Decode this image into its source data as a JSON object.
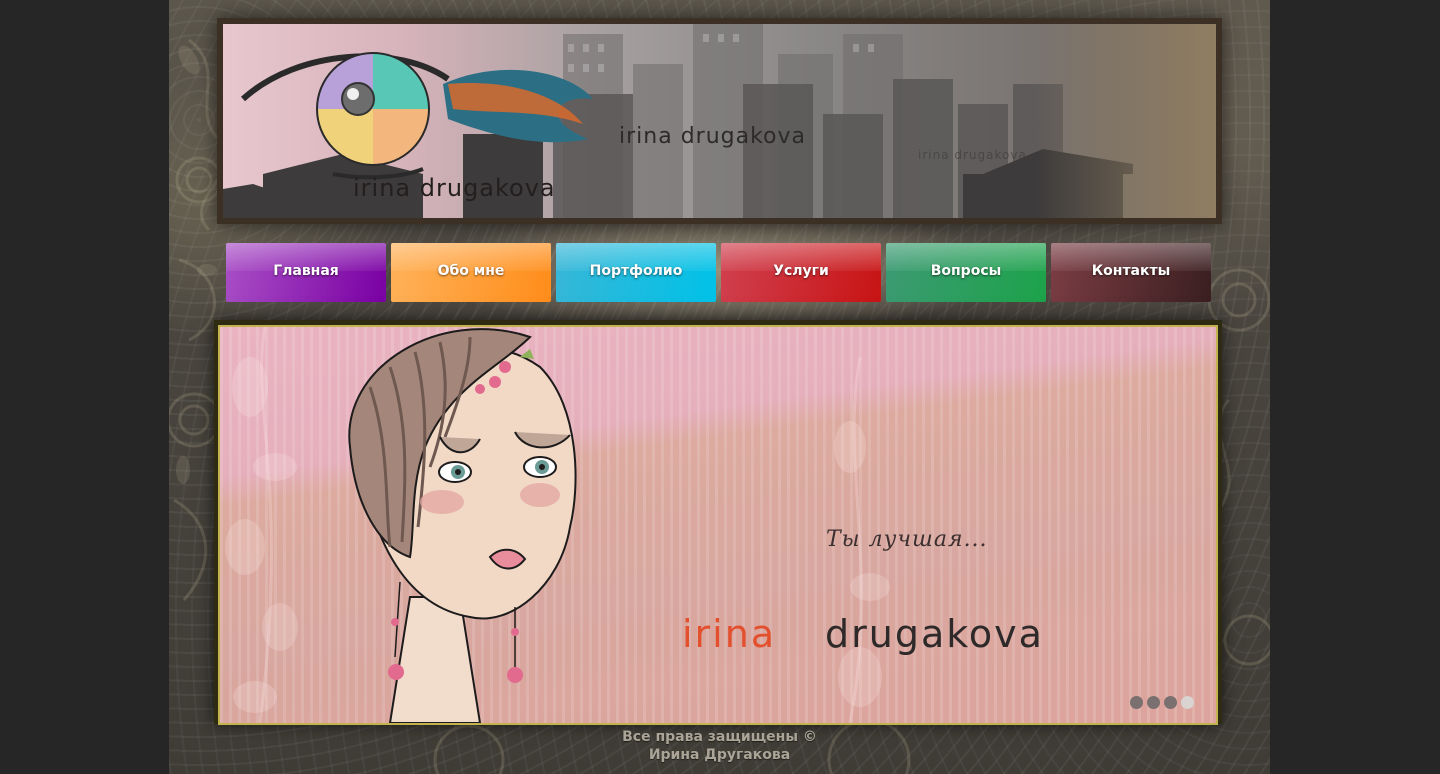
{
  "header": {
    "logo_text": "irina drugakova",
    "logo_text_mid": "irina drugakova",
    "logo_text_small": "irina drugakova"
  },
  "nav": {
    "items": [
      {
        "label": "Главная",
        "color_top": "#a94fc6",
        "color_bottom": "#7a00a3"
      },
      {
        "label": "Обо мне",
        "color_top": "#ffb25a",
        "color_bottom": "#ff8d1a"
      },
      {
        "label": "Портфолио",
        "color_top": "#38b6d6",
        "color_bottom": "#00c2e8"
      },
      {
        "label": "Услуги",
        "color_top": "#d0404f",
        "color_bottom": "#c81414"
      },
      {
        "label": "Вопросы",
        "color_top": "#3c9a73",
        "color_bottom": "#1da34a"
      },
      {
        "label": "Контакты",
        "color_top": "#7b3d44",
        "color_bottom": "#3a1f20"
      }
    ]
  },
  "slider": {
    "caption": "Ты лучшая...",
    "brand_first": "irina",
    "brand_last": "drugakova",
    "slides_count": 4,
    "active_slide": 4
  },
  "footer": {
    "line1": "Все права защищены ©",
    "line2": "Ирина Другакова"
  }
}
